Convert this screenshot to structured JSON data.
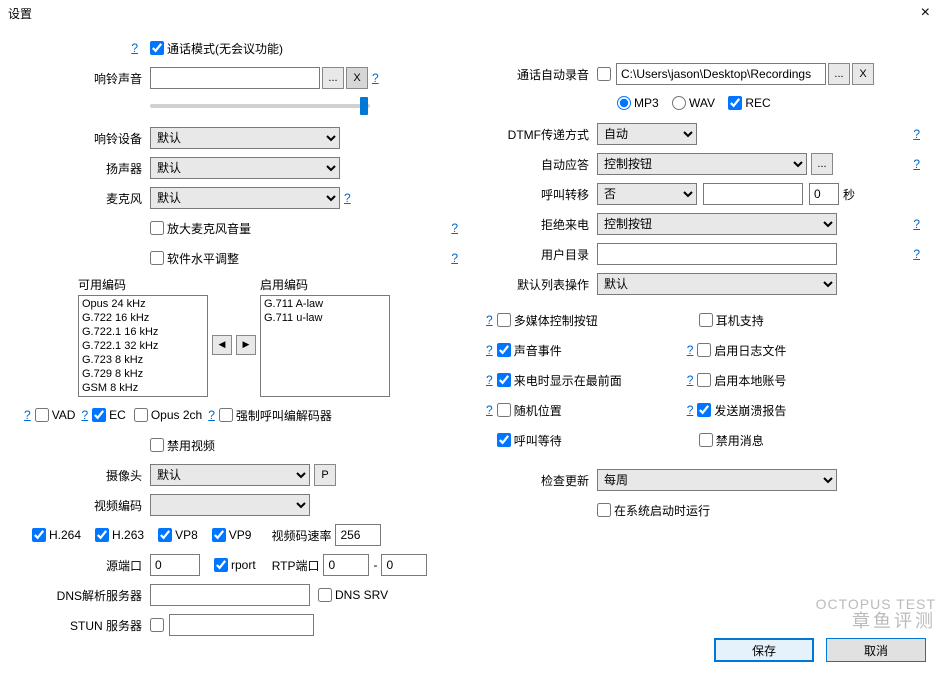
{
  "window": {
    "title": "设置",
    "close": "×"
  },
  "left": {
    "call_mode": "通话模式(无会议功能)",
    "ring_sound_label": "响铃声音",
    "ring_sound_value": "",
    "browse": "...",
    "x_btn": "X",
    "ring_device_label": "响铃设备",
    "speaker_label": "扬声器",
    "mic_label": "麦克风",
    "default_opt": "默认",
    "amplify_mic": "放大麦克风音量",
    "software_level": "软件水平调整",
    "avail_codec_title": "可用编码",
    "enabled_codec_title": "启用编码",
    "avail_codecs": [
      "Opus 24 kHz",
      "G.722 16 kHz",
      "G.722.1 16 kHz",
      "G.722.1 32 kHz",
      "G.723 8 kHz",
      "G.729 8 kHz",
      "GSM 8 kHz"
    ],
    "enabled_codecs": [
      "G.711 A-law",
      "G.711 u-law"
    ],
    "vad": "VAD",
    "ec": "EC",
    "opus2ch": "Opus 2ch",
    "force_codec": "强制呼叫编解码器",
    "disable_video": "禁用视频",
    "camera_label": "摄像头",
    "video_codec_label": "视频编码",
    "h264": "H.264",
    "h263": "H.263",
    "vp8": "VP8",
    "vp9": "VP9",
    "video_bitrate_label": "视频码速率",
    "video_bitrate_value": "256",
    "source_port_label": "源端口",
    "source_port_value": "0",
    "rport": "rport",
    "rtp_port_label": "RTP端口",
    "rtp_port_a": "0",
    "rtp_port_b": "0",
    "dns_label": "DNS解析服务器",
    "dns_srv": "DNS SRV",
    "stun_label": "STUN 服务器",
    "p_btn": "P"
  },
  "right": {
    "auto_record_label": "通话自动录音",
    "record_path": "C:\\Users\\jason\\Desktop\\Recordings",
    "mp3": "MP3",
    "wav": "WAV",
    "rec": "REC",
    "dtmf_label": "DTMF传递方式",
    "dtmf_opt": "自动",
    "auto_answer_label": "自动应答",
    "control_btn_opt": "控制按钮",
    "call_forward_label": "呼叫转移",
    "no_opt": "否",
    "seconds_label": "秒",
    "seconds_value": "0",
    "reject_label": "拒绝来电",
    "user_dir_label": "用户目录",
    "default_list_label": "默认列表操作",
    "default_opt": "默认",
    "multimedia_btn": "多媒体控制按钮",
    "sound_events": "声音事件",
    "show_front": "来电时显示在最前面",
    "random_pos": "随机位置",
    "call_waiting": "呼叫等待",
    "headset": "耳机支持",
    "enable_log": "启用日志文件",
    "enable_local": "启用本地账号",
    "send_crash": "发送崩溃报告",
    "disable_msg": "禁用消息",
    "check_update_label": "检查更新",
    "weekly_opt": "每周",
    "run_on_startup": "在系统启动时运行"
  },
  "footer": {
    "save": "保存",
    "cancel": "取消"
  },
  "watermark": {
    "en": "OCTOPUS TEST",
    "cn": "章鱼评测"
  }
}
